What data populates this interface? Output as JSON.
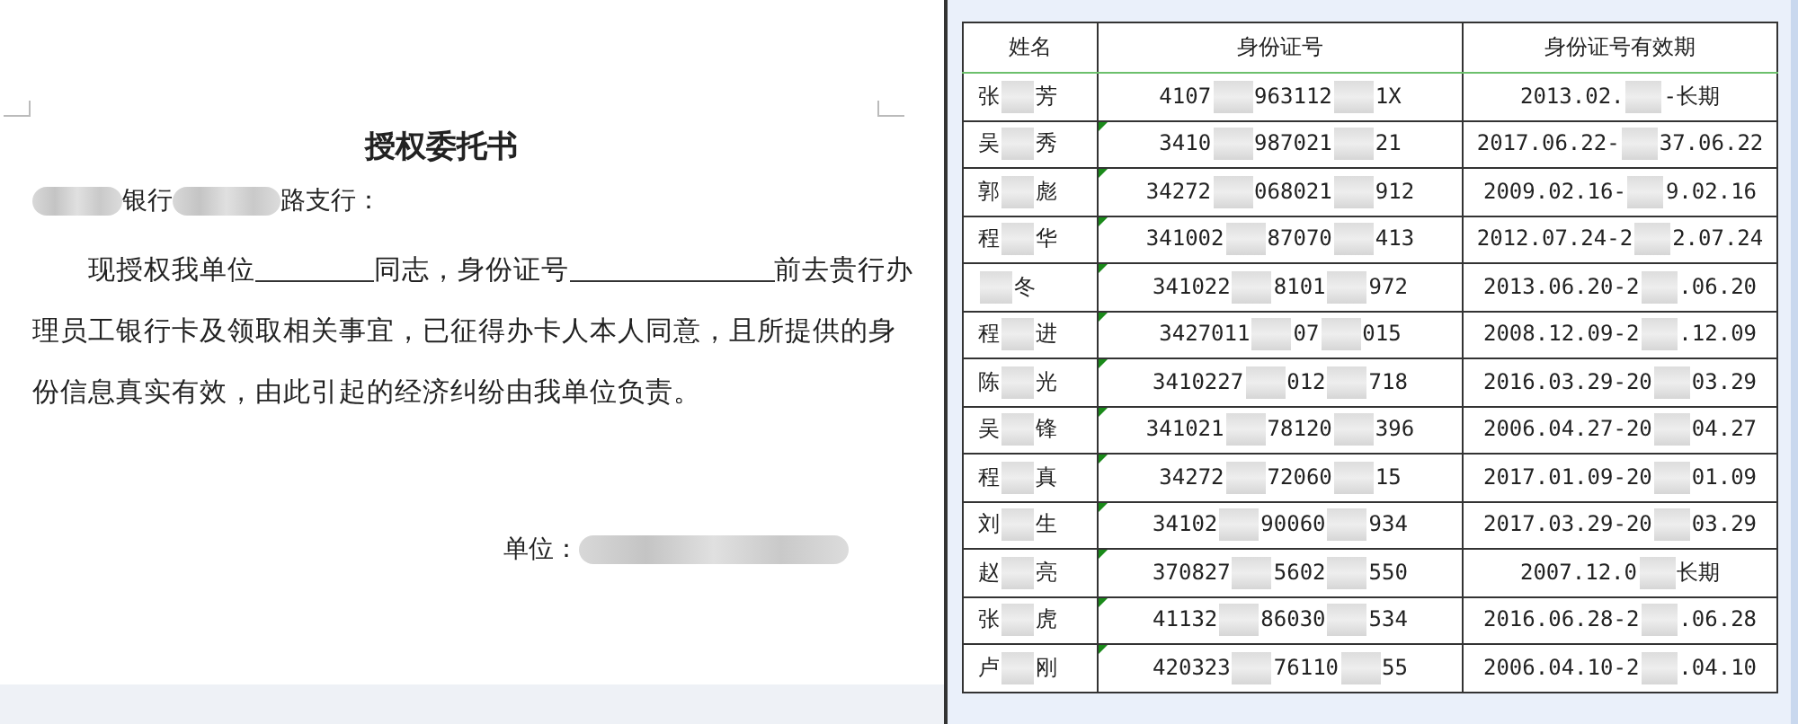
{
  "document": {
    "title": "授权委托书",
    "salutation": {
      "leading_redaction": true,
      "parts": [
        "银行",
        "路支行："
      ]
    },
    "body": {
      "parts": [
        "现授权我单位",
        "同志，身份证号",
        "前去贵行办理员工银行卡及领取相关事宜，已征得办卡人本人同意，且所提供的身份信息真实有效，由此引起的经济纠纷由我单位负责。"
      ]
    },
    "signature": {
      "label": "单位：",
      "redacted": true
    }
  },
  "table": {
    "columns": [
      "姓名",
      "身份证号",
      "身份证号有效期"
    ],
    "rows": [
      {
        "cells": [
          {
            "parts": [
              "张",
              "芳"
            ]
          },
          {
            "parts": [
              "4107",
              "963112",
              "1X"
            ]
          },
          {
            "parts": [
              "2013.02.",
              "-长期"
            ]
          }
        ]
      },
      {
        "cells": [
          {
            "parts": [
              "吴",
              "秀"
            ]
          },
          {
            "parts": [
              "3410",
              "987021",
              "21"
            ]
          },
          {
            "parts": [
              "2017.06.22-",
              "37.06.22"
            ]
          }
        ]
      },
      {
        "cells": [
          {
            "parts": [
              "郭",
              "彪"
            ]
          },
          {
            "parts": [
              "34272",
              "068021",
              "912"
            ]
          },
          {
            "parts": [
              "2009.02.16-",
              "9.02.16"
            ]
          }
        ]
      },
      {
        "cells": [
          {
            "parts": [
              "程",
              "华"
            ]
          },
          {
            "parts": [
              "341002",
              "87070",
              "413"
            ]
          },
          {
            "parts": [
              "2012.07.24-2",
              "2.07.24"
            ]
          }
        ]
      },
      {
        "cells": [
          {
            "leading_redaction": true,
            "parts": [
              "冬"
            ]
          },
          {
            "parts": [
              "341022",
              "8101",
              "972"
            ]
          },
          {
            "parts": [
              "2013.06.20-2",
              ".06.20"
            ]
          }
        ]
      },
      {
        "cells": [
          {
            "parts": [
              "程",
              "进"
            ]
          },
          {
            "parts": [
              "3427011",
              "07",
              "015"
            ]
          },
          {
            "parts": [
              "2008.12.09-2",
              ".12.09"
            ]
          }
        ]
      },
      {
        "cells": [
          {
            "parts": [
              "陈",
              "光"
            ]
          },
          {
            "parts": [
              "3410227",
              "012",
              "718"
            ]
          },
          {
            "parts": [
              "2016.03.29-20",
              "03.29"
            ]
          }
        ]
      },
      {
        "cells": [
          {
            "parts": [
              "吴",
              "锋"
            ]
          },
          {
            "parts": [
              "341021",
              "78120",
              "396"
            ]
          },
          {
            "parts": [
              "2006.04.27-20",
              "04.27"
            ]
          }
        ]
      },
      {
        "cells": [
          {
            "parts": [
              "程",
              "真"
            ]
          },
          {
            "parts": [
              "34272",
              "72060",
              "15"
            ]
          },
          {
            "parts": [
              "2017.01.09-20",
              "01.09"
            ]
          }
        ]
      },
      {
        "cells": [
          {
            "parts": [
              "刘",
              "生"
            ]
          },
          {
            "parts": [
              "34102",
              "90060",
              "934"
            ]
          },
          {
            "parts": [
              "2017.03.29-20",
              "03.29"
            ]
          }
        ]
      },
      {
        "cells": [
          {
            "parts": [
              "赵",
              "亮"
            ]
          },
          {
            "parts": [
              "370827",
              "5602",
              "550"
            ]
          },
          {
            "parts": [
              "2007.12.0",
              "长期"
            ]
          }
        ]
      },
      {
        "cells": [
          {
            "parts": [
              "张",
              "虎"
            ]
          },
          {
            "parts": [
              "41132",
              "86030",
              "534"
            ]
          },
          {
            "parts": [
              "2016.06.28-2",
              ".06.28"
            ]
          }
        ]
      },
      {
        "cells": [
          {
            "parts": [
              "卢",
              "刚"
            ]
          },
          {
            "parts": [
              "420323",
              "76110",
              "55"
            ]
          },
          {
            "parts": [
              "2006.04.10-2",
              ".04.10"
            ]
          }
        ]
      }
    ]
  }
}
